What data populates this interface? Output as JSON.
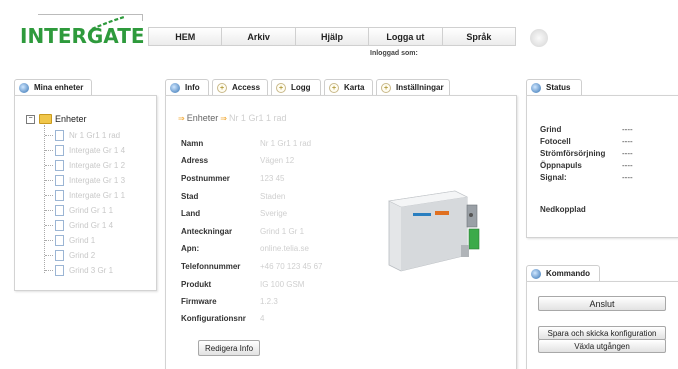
{
  "logo": {
    "text": "INTERGATE"
  },
  "nav": {
    "items": [
      "HEM",
      "Arkiv",
      "Hjälp",
      "Logga ut",
      "Språk"
    ],
    "logged_in": "Inloggad som:"
  },
  "left": {
    "tab": "Mina enheter",
    "root": "Enheter",
    "items": [
      "Nr 1 Gr1 1 rad",
      "Intergate Gr 1 4",
      "Intergate Gr 1 2",
      "Intergate Gr 1 3",
      "Intergate Gr 1 1",
      "Grind Gr 1 1",
      "Grind Gr 1 4",
      "Grind 1",
      "Grind 2",
      "Grind 3 Gr 1"
    ]
  },
  "center": {
    "tabs": [
      "Info",
      "Access",
      "Logg",
      "Karta",
      "Inställningar"
    ],
    "breadcrumb": [
      "Enheter",
      "Nr 1 Gr1 1 rad"
    ],
    "fields": [
      {
        "label": "Namn",
        "value": "Nr 1 Gr1 1 rad"
      },
      {
        "label": "Adress",
        "value": "Vägen 12"
      },
      {
        "label": "Postnummer",
        "value": "123 45"
      },
      {
        "label": "Stad",
        "value": "Staden"
      },
      {
        "label": "Land",
        "value": "Sverige"
      },
      {
        "label": "Anteckningar",
        "value": "Grind 1 Gr 1"
      },
      {
        "label": "Apn:",
        "value": "online.telia.se"
      },
      {
        "label": "Telefonnummer",
        "value": "+46 70 123 45 67"
      },
      {
        "label": "Produkt",
        "value": "IG 100 GSM"
      },
      {
        "label": "Firmware",
        "value": "1.2.3"
      },
      {
        "label": "Konfigurationsnr",
        "value": "4"
      }
    ],
    "edit_button": "Redigera Info"
  },
  "status": {
    "tab": "Status",
    "rows": [
      {
        "label": "Grind",
        "value": "----"
      },
      {
        "label": "Fotocell",
        "value": "----"
      },
      {
        "label": "Strömförsörjning",
        "value": "----"
      },
      {
        "label": "Öppnapuls",
        "value": "----"
      },
      {
        "label": "Signal:",
        "value": "----"
      }
    ],
    "connection": "Nedkopplad"
  },
  "command": {
    "tab": "Kommando",
    "connect": "Anslut",
    "save_send": "Spara och skicka konfiguration",
    "toggle": "Växla utgången"
  },
  "colors": {
    "brand_green": "#2e9a3c",
    "tab_icon_blue": "#2f6fb0",
    "crumb_arrow": "#f0a020"
  }
}
